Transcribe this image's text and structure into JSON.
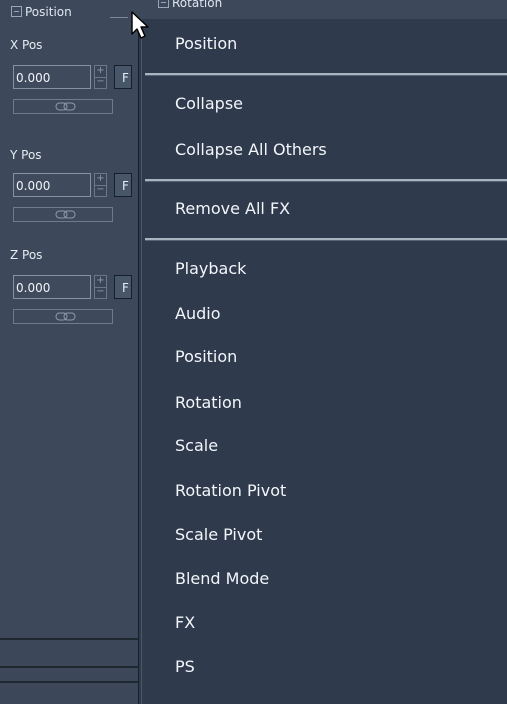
{
  "panel": {
    "groups": [
      {
        "label": "Position"
      },
      {
        "label": "Rotation"
      }
    ],
    "fields": [
      {
        "label": "X Pos",
        "value": "0.000",
        "side_label": "F",
        "stepper_up": "+",
        "stepper_down": "−"
      },
      {
        "label": "Y Pos",
        "value": "0.000",
        "side_label": "F",
        "stepper_up": "+",
        "stepper_down": "−"
      },
      {
        "label": "Z Pos",
        "value": "0.000",
        "side_label": "F",
        "stepper_up": "+",
        "stepper_down": "−"
      }
    ]
  },
  "context_menu": {
    "items": [
      {
        "label": "Position"
      },
      {
        "label": "Collapse"
      },
      {
        "label": "Collapse All Others"
      },
      {
        "label": "Remove All FX"
      },
      {
        "label": "Playback"
      },
      {
        "label": "Audio"
      },
      {
        "label": "Position"
      },
      {
        "label": "Rotation"
      },
      {
        "label": "Scale"
      },
      {
        "label": "Rotation Pivot"
      },
      {
        "label": "Scale Pivot"
      },
      {
        "label": "Blend Mode"
      },
      {
        "label": "FX"
      },
      {
        "label": "PS"
      }
    ]
  },
  "icons": {
    "cursor": "mouse-pointer-icon",
    "link": "link-chain-icon",
    "collapse": "collapse-minus-icon"
  },
  "colors": {
    "panel_bg": "#3d495b",
    "menu_bg": "#2f3b4d",
    "menu_text": "#f3f6fa",
    "separator": "#a9b4c1"
  }
}
